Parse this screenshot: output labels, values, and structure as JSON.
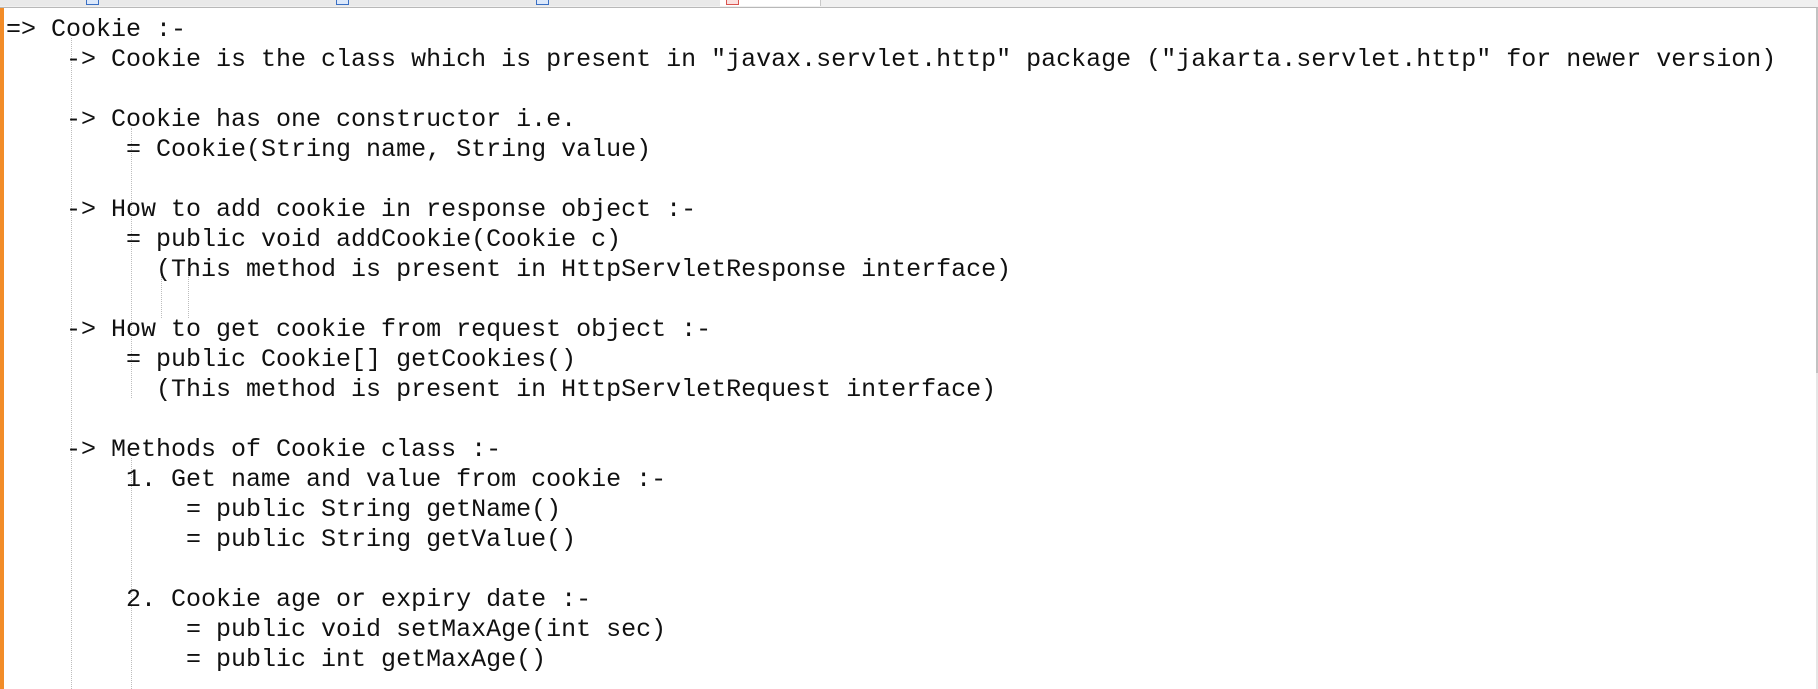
{
  "editor": {
    "lines": [
      "=> Cookie :-",
      "    -> Cookie is the class which is present in \"javax.servlet.http\" package (\"jakarta.servlet.http\" for newer version)",
      "",
      "    -> Cookie has one constructor i.e.",
      "        = Cookie(String name, String value)",
      "",
      "    -> How to add cookie in response object :-",
      "        = public void addCookie(Cookie c)",
      "          (This method is present in HttpServletResponse interface)",
      "",
      "    -> How to get cookie from request object :-",
      "        = public Cookie[] getCookies()",
      "          (This method is present in HttpServletRequest interface)",
      "",
      "    -> Methods of Cookie class :-",
      "        1. Get name and value from cookie :-",
      "            = public String getName()",
      "            = public String getValue()",
      "",
      "        2. Cookie age or expiry date :-",
      "            = public void setMaxAge(int sec)",
      "            = public int getMaxAge()",
      ""
    ]
  }
}
